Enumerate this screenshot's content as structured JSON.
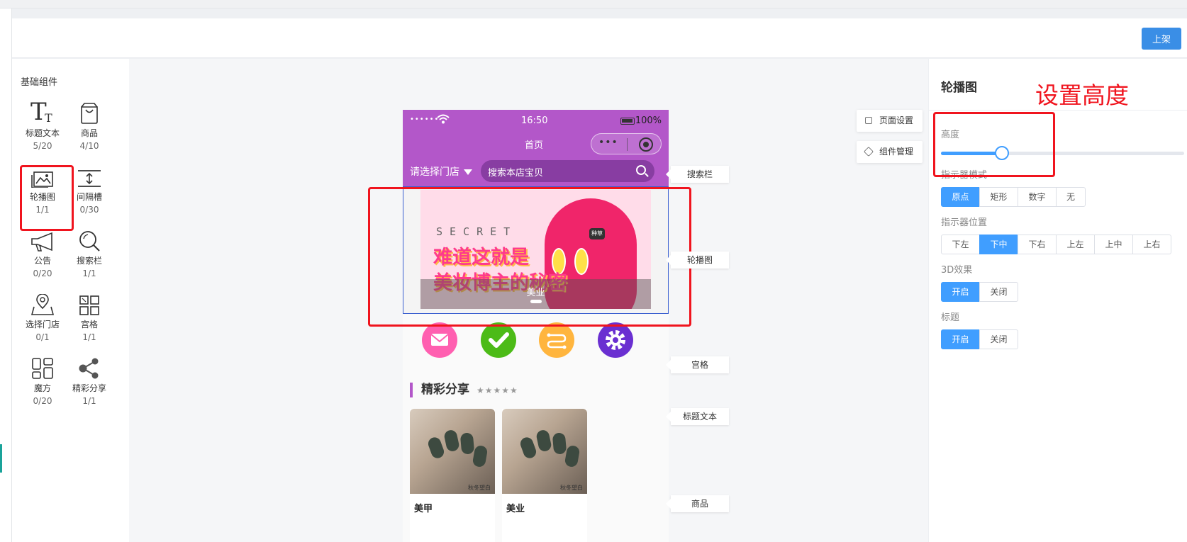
{
  "header": {
    "publish_label": "上架"
  },
  "components": {
    "title": "基础组件",
    "items": [
      {
        "name": "标题文本",
        "count": "5/20",
        "icon": "title-text-icon"
      },
      {
        "name": "商品",
        "count": "4/10",
        "icon": "goods-bag-icon"
      },
      {
        "name": "轮播图",
        "count": "1/1",
        "icon": "carousel-image-icon"
      },
      {
        "name": "间隔槽",
        "count": "0/30",
        "icon": "spacer-icon"
      },
      {
        "name": "公告",
        "count": "0/20",
        "icon": "megaphone-icon"
      },
      {
        "name": "搜索栏",
        "count": "1/1",
        "icon": "search-icon"
      },
      {
        "name": "选择门店",
        "count": "0/1",
        "icon": "map-pin-icon"
      },
      {
        "name": "宫格",
        "count": "1/1",
        "icon": "grid-icon"
      },
      {
        "name": "魔方",
        "count": "0/20",
        "icon": "cube-layout-icon"
      },
      {
        "name": "精彩分享",
        "count": "1/1",
        "icon": "share-icon"
      }
    ]
  },
  "phone": {
    "signal": "••••••",
    "time": "16:50",
    "battery": "100%",
    "nav_title": "首页",
    "capsule_dots": "•••",
    "store_select": "请选择门店",
    "search_placeholder": "搜索本店宝贝",
    "carousel": {
      "secret_text": "SECRET",
      "headline_line1": "难道这就是",
      "headline_line2": "美妆博主的秘密",
      "badge": "种草",
      "caption": "美业"
    },
    "grid_icons": [
      {
        "icon": "mail-icon",
        "color": "#ff5fb0"
      },
      {
        "icon": "check-icon",
        "color": "#4cbb17"
      },
      {
        "icon": "route-icon",
        "color": "#ffb53e"
      },
      {
        "icon": "gear-icon",
        "color": "#6a2fd1"
      }
    ],
    "section_title": "精彩分享",
    "section_stars": "★★★★★",
    "goods": [
      {
        "name": "美甲",
        "watermark": "秋冬望白"
      },
      {
        "name": "美业",
        "watermark": "秋冬望白"
      }
    ]
  },
  "side_tags": {
    "search": "搜索栏",
    "carousel": "轮播图",
    "grid": "宫格",
    "title_text": "标题文本",
    "goods": "商品"
  },
  "float_buttons": {
    "page_settings": "页面设置",
    "component_manage": "组件管理"
  },
  "settings": {
    "title": "轮播图",
    "annotation": "设置高度",
    "height_label": "高度",
    "height_value_fraction": 0.25,
    "indicator_style_label": "指示器模式",
    "indicator_style_options": [
      "原点",
      "矩形",
      "数字",
      "无"
    ],
    "indicator_style_selected": "原点",
    "indicator_pos_label": "指示器位置",
    "indicator_pos_options": [
      "下左",
      "下中",
      "下右",
      "上左",
      "上中",
      "上右"
    ],
    "indicator_pos_selected": "下中",
    "effect3d_label": "3D效果",
    "effect3d_options": [
      "开启",
      "关闭"
    ],
    "effect3d_selected": "开启",
    "title_label": "标题",
    "title_options": [
      "开启",
      "关闭"
    ],
    "title_selected": "开启"
  },
  "colors": {
    "brand_purple": "#b357c9",
    "primary_blue": "#409eff",
    "annotation_red": "#f0141e"
  }
}
